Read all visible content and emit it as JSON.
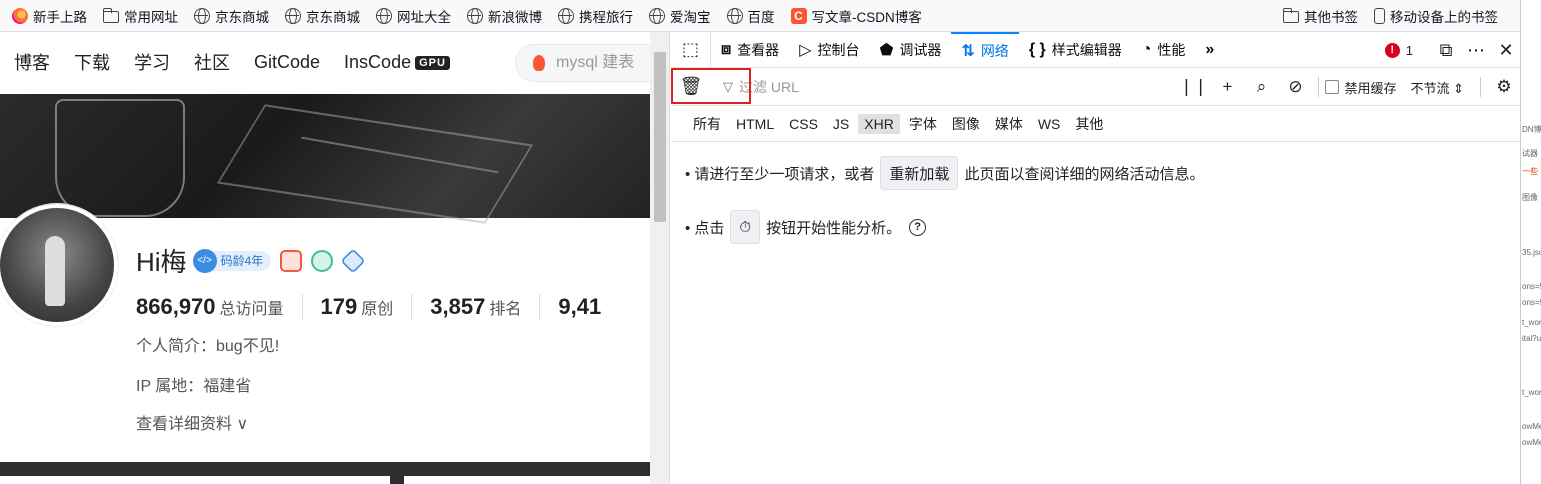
{
  "bookmarks": {
    "items": [
      {
        "label": "新手上路",
        "icon": "firefox-icon"
      },
      {
        "label": "常用网址",
        "icon": "folder-icon"
      },
      {
        "label": "京东商城",
        "icon": "globe-icon"
      },
      {
        "label": "京东商城",
        "icon": "globe-icon"
      },
      {
        "label": "网址大全",
        "icon": "globe-icon"
      },
      {
        "label": "新浪微博",
        "icon": "globe-icon"
      },
      {
        "label": "携程旅行",
        "icon": "globe-icon"
      },
      {
        "label": "爱淘宝",
        "icon": "globe-icon"
      },
      {
        "label": "百度",
        "icon": "globe-icon"
      },
      {
        "label": "写文章-CSDN博客",
        "icon": "csdn-icon"
      }
    ],
    "other": "其他书签",
    "mobile": "移动设备上的书签"
  },
  "site": {
    "nav": [
      "博客",
      "下载",
      "学习",
      "社区",
      "GitCode",
      "InsCode"
    ],
    "gpu_badge": "GPU",
    "search_placeholder": "mysql 建表",
    "profile": {
      "name": "Hi梅",
      "age_badge": "码龄4年",
      "stats": [
        {
          "num": "866,970",
          "label": "总访问量"
        },
        {
          "num": "179",
          "label": "原创"
        },
        {
          "num": "3,857",
          "label": "排名"
        },
        {
          "num": "9,41",
          "label": ""
        }
      ],
      "bio": "个人简介：bug不见!",
      "ip": "IP 属地：福建省",
      "more": "查看详细资料"
    }
  },
  "devtools": {
    "tabs": [
      {
        "label": "查看器",
        "icon": "inspector-icon"
      },
      {
        "label": "控制台",
        "icon": "console-icon"
      },
      {
        "label": "调试器",
        "icon": "debugger-icon"
      },
      {
        "label": "网络",
        "icon": "network-icon",
        "active": true
      },
      {
        "label": "样式编辑器",
        "icon": "style-editor-icon"
      },
      {
        "label": "性能",
        "icon": "performance-icon"
      }
    ],
    "error_count": "1",
    "filter_placeholder": "过滤 URL",
    "disable_cache": "禁用缓存",
    "throttle": "不节流",
    "types": [
      "所有",
      "HTML",
      "CSS",
      "JS",
      "XHR",
      "字体",
      "图像",
      "媒体",
      "WS",
      "其他"
    ],
    "active_type": "XHR",
    "empty_line1_pre": "• 请进行至少一项请求，或者",
    "reload_btn": "重新加载",
    "empty_line1_post": "此页面以查阅详细的网络活动信息。",
    "empty_line2_pre": "• 点击",
    "empty_line2_post": "按钮开始性能分析。",
    "accent": "#0a84ff",
    "highlight_color": "#e02020"
  },
  "right_strip": [
    "DN博",
    "试器",
    "一些",
    "图像",
    "35.jso",
    "ons=5",
    "ons=9",
    "t_wor",
    "ital?u",
    "t_wor",
    "owMe",
    "owMe"
  ]
}
